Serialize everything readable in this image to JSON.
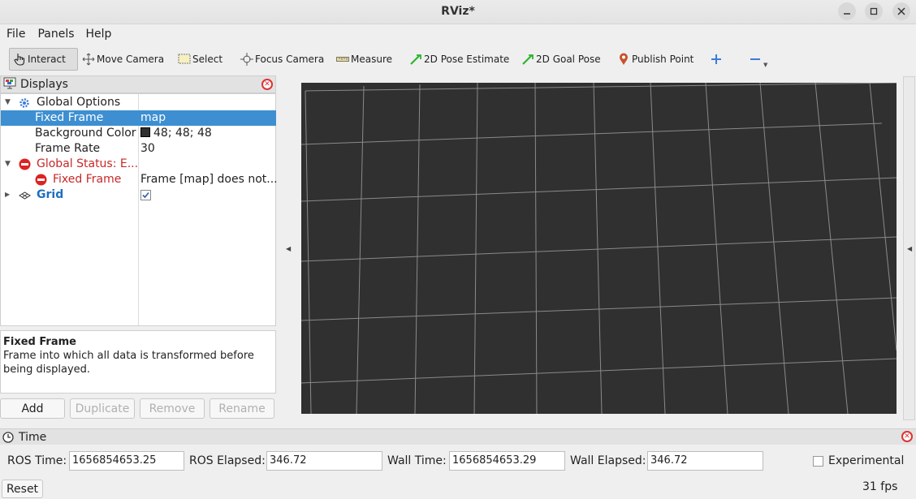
{
  "window": {
    "title": "RViz*"
  },
  "menu": [
    "File",
    "Panels",
    "Help"
  ],
  "toolbar": {
    "tools": [
      "Interact",
      "Move Camera",
      "Select",
      "Focus Camera",
      "Measure",
      "2D Pose Estimate",
      "2D Goal Pose",
      "Publish Point"
    ]
  },
  "displays": {
    "title": "Displays",
    "rows": {
      "global_options": {
        "label": "Global Options"
      },
      "fixed_frame": {
        "label": "Fixed Frame",
        "value": "map"
      },
      "background_color": {
        "label": "Background Color",
        "value": "48; 48; 48",
        "swatch": "#303030"
      },
      "frame_rate": {
        "label": "Frame Rate",
        "value": "30"
      },
      "global_status": {
        "label": "Global Status: E..."
      },
      "status_fixed_frame": {
        "label": "Fixed Frame",
        "value": "Frame [map] does not..."
      },
      "grid": {
        "label": "Grid",
        "checked": true
      }
    },
    "description": {
      "title": "Fixed Frame",
      "text": "Frame into which all data is transformed before being displayed."
    },
    "buttons": {
      "add": "Add",
      "duplicate": "Duplicate",
      "remove": "Remove",
      "rename": "Rename"
    }
  },
  "viewport": {
    "background": "#303030",
    "grid_color": "#a0a0a0"
  },
  "time_panel": {
    "title": "Time",
    "ros_time_label": "ROS Time:",
    "ros_time": "1656854653.25",
    "ros_elapsed_label": "ROS Elapsed:",
    "ros_elapsed": "346.72",
    "wall_time_label": "Wall Time:",
    "wall_time": "1656854653.29",
    "wall_elapsed_label": "Wall Elapsed:",
    "wall_elapsed": "346.72",
    "experimental_label": "Experimental",
    "reset_label": "Reset",
    "fps": "31 fps"
  }
}
